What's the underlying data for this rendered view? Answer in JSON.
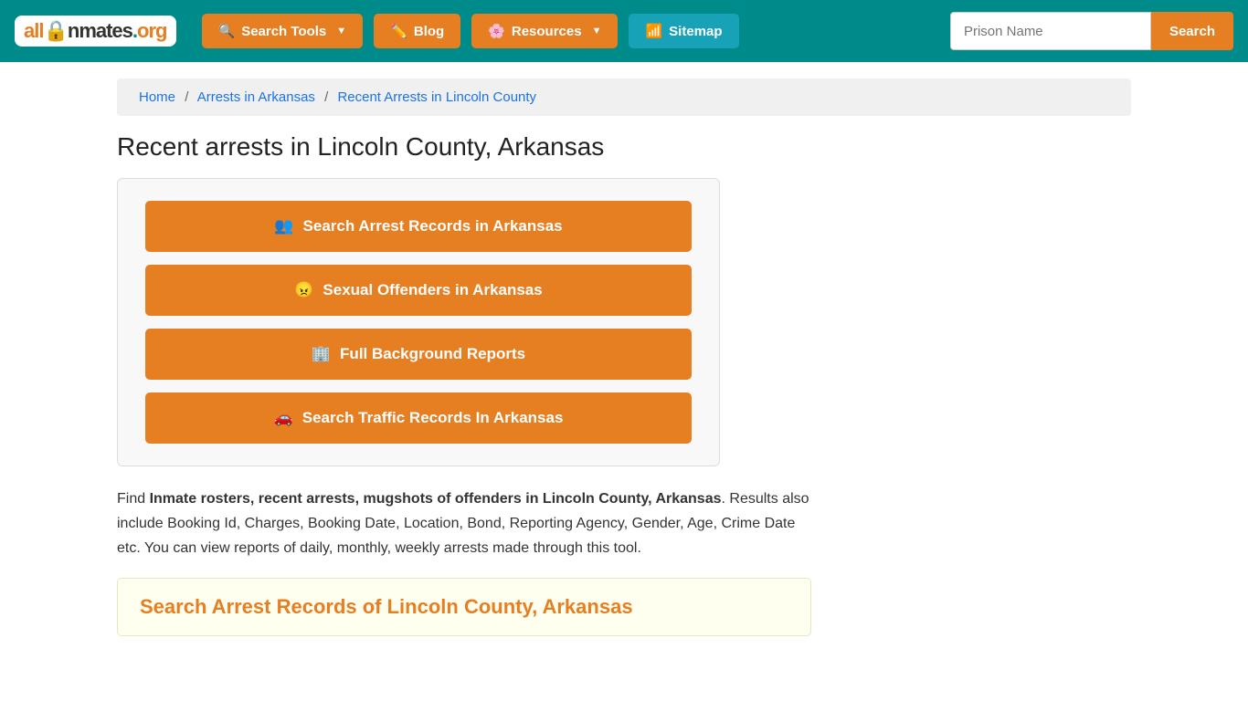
{
  "nav": {
    "logo": "all🔒nmates.org",
    "logo_all": "all",
    "logo_inmates": "nmates",
    "logo_org": ".org",
    "search_tools_label": "Search Tools",
    "blog_label": "Blog",
    "resources_label": "Resources",
    "sitemap_label": "Sitemap",
    "search_placeholder": "Prison Name",
    "search_button_label": "Search"
  },
  "breadcrumb": {
    "home": "Home",
    "arrests_in_arkansas": "Arrests in Arkansas",
    "current": "Recent Arrests in Lincoln County"
  },
  "page": {
    "title": "Recent arrests in Lincoln County, Arkansas"
  },
  "buttons": {
    "search_arrest": "Search Arrest Records in Arkansas",
    "sexual_offenders": "Sexual Offenders in Arkansas",
    "background_reports": "Full Background Reports",
    "traffic_records": "Search Traffic Records In Arkansas"
  },
  "description": {
    "intro": "Find ",
    "bold1": "Inmate rosters, recent arrests, mugshots of offenders in Lincoln County, Arkansas",
    "rest": ". Results also include Booking Id, Charges, Booking Date, Location, Bond, Reporting Agency, Gender, Age, Crime Date etc. You can view reports of daily, monthly, weekly arrests made through this tool."
  },
  "section_search": {
    "title": "Search Arrest Records of Lincoln County, Arkansas"
  }
}
